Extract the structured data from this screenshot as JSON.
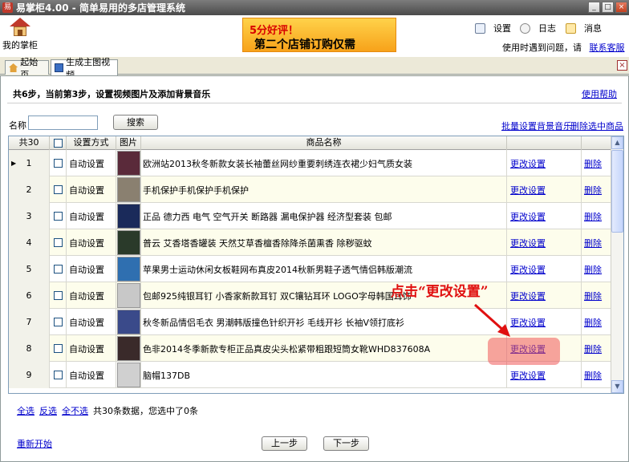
{
  "window": {
    "title": "易掌柜4.00 - 简单易用的多店管理系统",
    "app_icon": "易",
    "controls": [
      "_",
      "□",
      "×"
    ]
  },
  "header": {
    "home_label": "我的掌柜",
    "banner_line1": "5分好评！",
    "banner_line2": "第二个店铺订购仅需",
    "links": {
      "settings": "设置",
      "log": "日志",
      "messages": "消息"
    },
    "help_prefix": "使用时遇到问题，请",
    "contact": "联系客服"
  },
  "tabs": [
    {
      "label": "起始页",
      "icon": "house-icon"
    },
    {
      "label": "生成主图视频",
      "icon": "image-icon"
    }
  ],
  "page": {
    "step_text": "共6步，当前第3步，设置视频图片及添加背景音乐",
    "help_link": "使用帮助",
    "name_label": "名称",
    "name_value": "",
    "search_button": "搜索",
    "batch_music": "批量设置背景音乐",
    "delete_selected": "删除选中商品"
  },
  "table": {
    "headers": {
      "count": "共30",
      "mode": "设置方式",
      "image": "图片",
      "name": "商品名称"
    },
    "rows": [
      {
        "idx": "1",
        "mode": "自动设置",
        "name": "欧洲站2013秋冬新款女装长袖蕾丝网纱重要刺绣连衣裙少妇气质女装",
        "edit": "更改设置",
        "del": "删除",
        "thumb_color": "#5a2a3a"
      },
      {
        "idx": "2",
        "mode": "自动设置",
        "name": "手机保护手机保护手机保护",
        "edit": "更改设置",
        "del": "删除",
        "thumb_color": "#8a8070"
      },
      {
        "idx": "3",
        "mode": "自动设置",
        "name": "正品 德力西 电气 空气开关 断路器 漏电保护器 经济型套装 包邮",
        "edit": "更改设置",
        "del": "删除",
        "thumb_color": "#1a2a5a"
      },
      {
        "idx": "4",
        "mode": "自动设置",
        "name": "普云 艾香塔香罐装 天然艾草香檀香除降杀菌熏香 除秽驱蚊",
        "edit": "更改设置",
        "del": "删除",
        "thumb_color": "#2a3a2a"
      },
      {
        "idx": "5",
        "mode": "自动设置",
        "name": "苹果男士运动休闲女板鞋网布真皮2014秋新男鞋子透气情侣韩版潮流",
        "edit": "更改设置",
        "del": "删除",
        "thumb_color": "#2f6fb0"
      },
      {
        "idx": "6",
        "mode": "自动设置",
        "name": "包邮925纯银耳钉 小香家新款耳钉 双C镶钻耳环 LOGO字母韩国耳饰",
        "edit": "更改设置",
        "del": "删除",
        "thumb_color": "#c8c8c8"
      },
      {
        "idx": "7",
        "mode": "自动设置",
        "name": "秋冬新品情侣毛衣 男潮韩版撞色针织开衫 毛线开衫 长袖V领打底衫",
        "edit": "更改设置",
        "del": "删除",
        "thumb_color": "#3a4a8a"
      },
      {
        "idx": "8",
        "mode": "自动设置",
        "name": "色非2014冬季新款专柜正品真皮尖头松紧带粗跟短筒女靴WHD837608A",
        "edit": "更改设置",
        "del": "删除",
        "thumb_color": "#3a2a2a"
      },
      {
        "idx": "9",
        "mode": "自动设置",
        "name": "脑帽137DB",
        "edit": "更改设置",
        "del": "删除",
        "thumb_color": "#d0d0d0"
      }
    ]
  },
  "annotation": {
    "text": "点击“更改设置”",
    "color": "#e01010"
  },
  "footer": {
    "select_all": "全选",
    "invert": "反选",
    "select_none": "全不选",
    "summary": "共30条数据，您选中了0条",
    "restart": "重新开始",
    "prev": "上一步",
    "next": "下一步"
  }
}
